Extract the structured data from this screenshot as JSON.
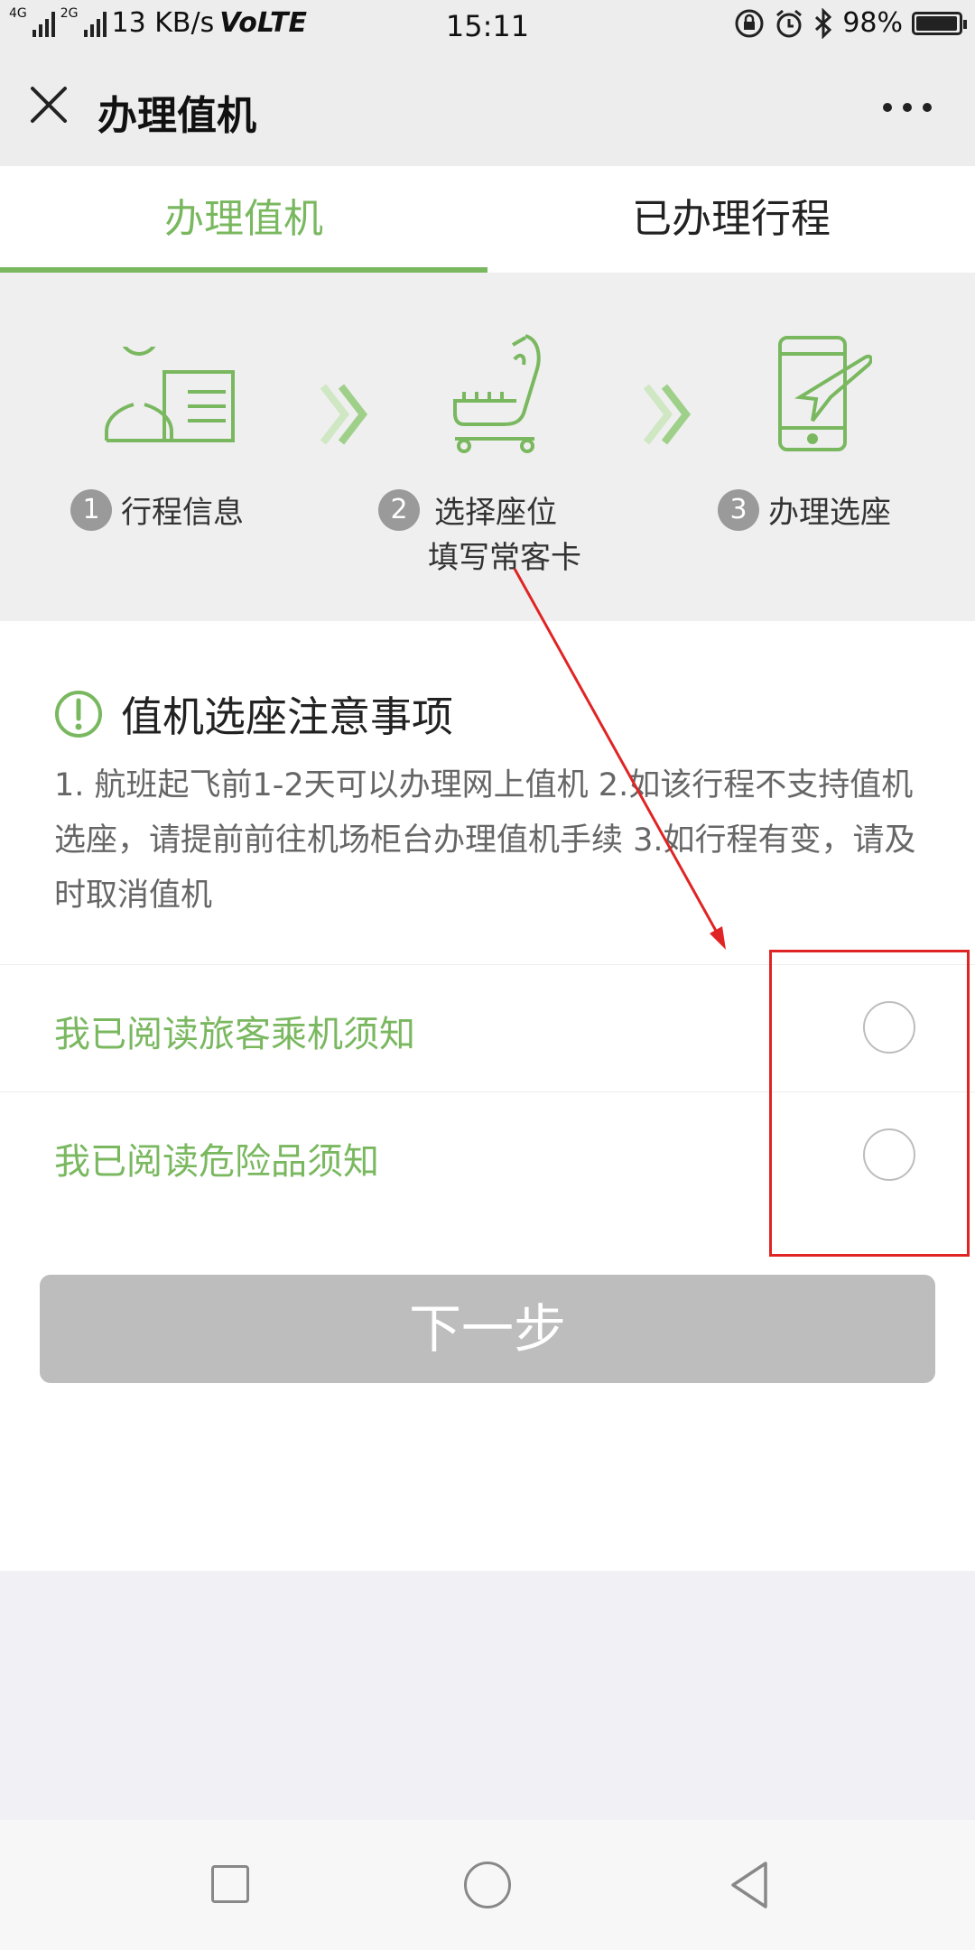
{
  "status_bar": {
    "network_top": "4G",
    "network_bottom": "2G",
    "speed": "13 KB/s",
    "volte": "VoLTE",
    "time": "15:11",
    "battery": "98%",
    "battery_level": 0.98
  },
  "header": {
    "title": "办理值机",
    "close_icon": "close-icon",
    "more_icon": "more-icon"
  },
  "tabs": [
    {
      "label": "办理值机",
      "active": true
    },
    {
      "label": "已办理行程",
      "active": false
    }
  ],
  "steps": [
    {
      "number": "1",
      "label": "行程信息",
      "icon": "user-card-icon"
    },
    {
      "number": "2",
      "label": "选择座位",
      "sublabel": "填写常客卡",
      "icon": "seat-icon"
    },
    {
      "number": "3",
      "label": "办理选座",
      "icon": "phone-plane-icon"
    }
  ],
  "notice": {
    "title": "值机选座注意事项",
    "text": "1. 航班起飞前1-2天可以办理网上值机 2.如该行程不支持值机选座，请提前前往机场柜台办理值机手续 3.如行程有变，请及时取消值机"
  },
  "agreements": [
    {
      "label": "我已阅读旅客乘机须知",
      "checked": false
    },
    {
      "label": "我已阅读危险品须知",
      "checked": false
    }
  ],
  "next_button": {
    "label": "下一步",
    "enabled": false
  },
  "colors": {
    "accent": "#7ab860",
    "annotation": "#e02424",
    "disabled_button": "#bdbdbd"
  }
}
